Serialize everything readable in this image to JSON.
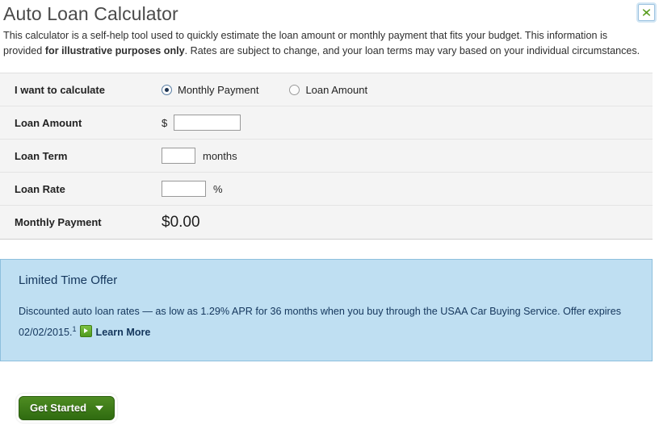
{
  "header": {
    "title": "Auto Loan Calculator",
    "intro_part1": "This calculator is a self-help tool used to quickly estimate the loan amount or monthly payment that fits your budget. This information is provided ",
    "intro_bold": "for illustrative purposes only",
    "intro_part2": ". Rates are subject to change, and your loan terms may vary based on your individual circumstances.",
    "close_icon": "close-x-icon"
  },
  "form": {
    "calculate": {
      "label": "I want to calculate",
      "options": [
        {
          "label": "Monthly Payment",
          "selected": true
        },
        {
          "label": "Loan Amount",
          "selected": false
        }
      ]
    },
    "loan_amount": {
      "label": "Loan Amount",
      "prefix": "$",
      "value": "",
      "placeholder": ""
    },
    "loan_term": {
      "label": "Loan Term",
      "value": "",
      "placeholder": "",
      "unit": "months"
    },
    "loan_rate": {
      "label": "Loan Rate",
      "value": "",
      "placeholder": "",
      "unit": "%"
    },
    "monthly_payment": {
      "label": "Monthly Payment",
      "value": "$0.00"
    }
  },
  "offer": {
    "title": "Limited Time Offer",
    "body": "Discounted auto loan rates — as low as 1.29% APR for 36 months when you buy through the USAA Car Buying Service. Offer expires 02/02/2015.",
    "footnote_marker": "1",
    "link_icon": "green-arrow-icon",
    "link_label": "Learn More"
  },
  "actions": {
    "get_started_label": "Get Started",
    "caret_icon": "caret-down-icon"
  },
  "colors": {
    "offer_background": "#bfdff2",
    "offer_border": "#8dbfdd",
    "offer_text": "#14365c",
    "button_green": "#4e8c22",
    "form_background": "#f4f4f4"
  }
}
